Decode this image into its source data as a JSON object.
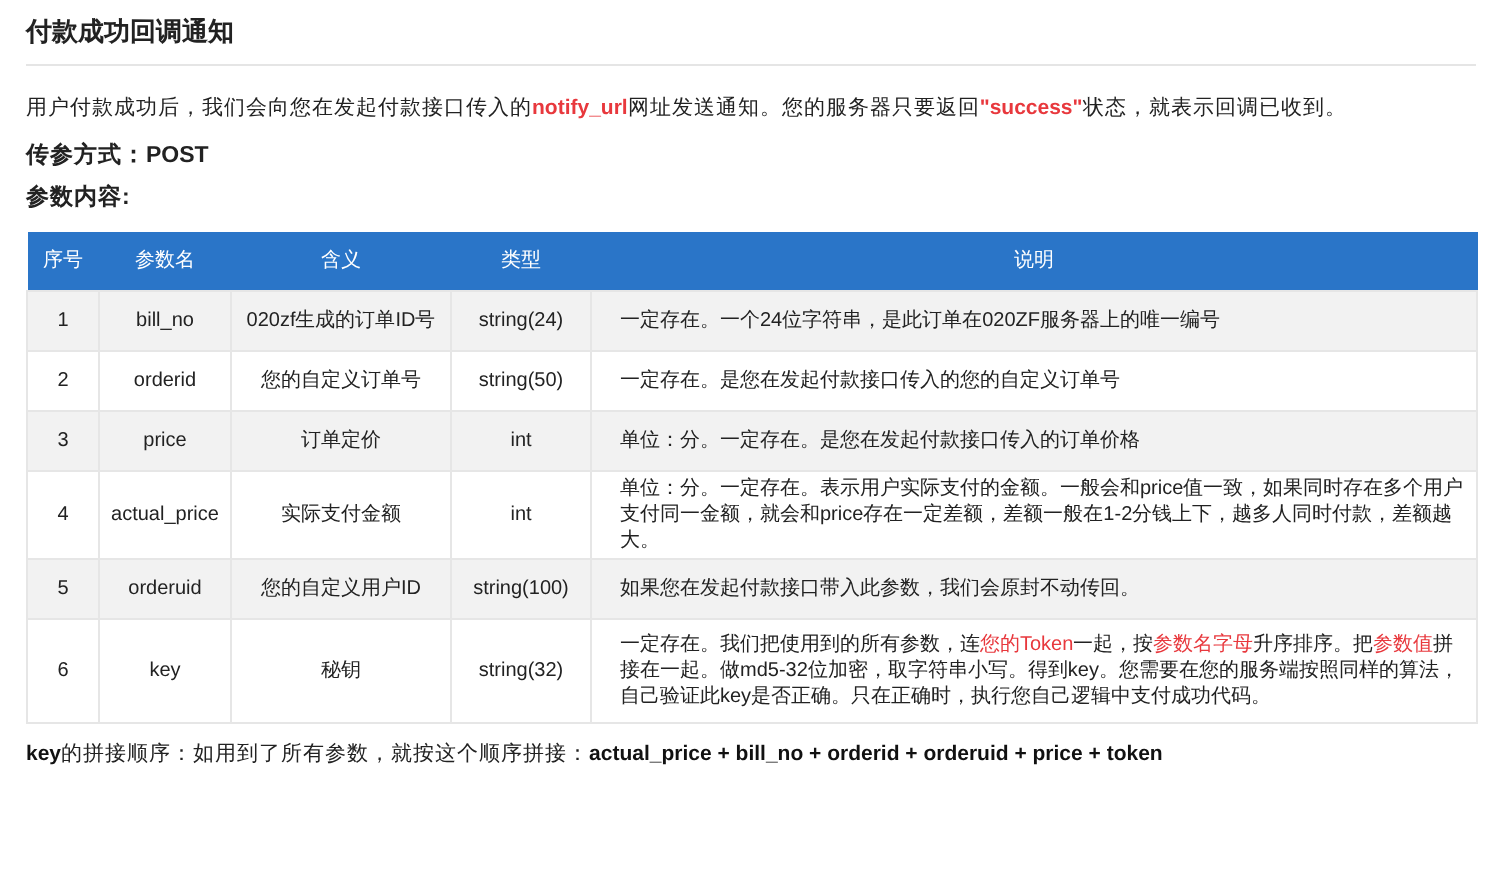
{
  "title": "付款成功回调通知",
  "intro": "用户付款成功后，我们会向您在发起付款接口传入的**notify_url**网址发送通知。您的服务器只要返回**\"success\"**状态，就表示回调已收到。",
  "method": "传参方式：POST",
  "params_heading": "参数内容:",
  "table": {
    "columns": [
      "序号",
      "参数名",
      "含义",
      "类型",
      "说明"
    ],
    "rows": [
      {
        "cells": [
          "1",
          "bill_no",
          "020zf生成的订单ID号",
          "string(24)",
          "一定存在。一个24位字符串，是此订单在020ZF服务器上的唯一编号"
        ]
      },
      {
        "cells": [
          "2",
          "orderid",
          "您的自定义订单号",
          "string(50)",
          "一定存在。是您在发起付款接口传入的您的自定义订单号"
        ]
      },
      {
        "cells": [
          "3",
          "price",
          "订单定价",
          "int",
          "单位：分。一定存在。是您在发起付款接口传入的订单价格"
        ]
      },
      {
        "cells": [
          "4",
          "actual_price",
          "实际支付金额",
          "int",
          "单位：分。一定存在。表示用户实际支付的金额。一般会和price值一致，如果同时存在多个用户支付同一金额，就会和price存在一定差额，差额一般在1-2分钱上下，越多人同时付款，差额越大。"
        ]
      },
      {
        "cells": [
          "5",
          "orderuid",
          "您的自定义用户ID",
          "string(100)",
          "如果您在发起付款接口带入此参数，我们会原封不动传回。"
        ]
      },
      {
        "cells": [
          "6",
          "key",
          "秘钥",
          "string(32)",
          "一定存在。我们把使用到的所有参数，连**您的Token**一起，按**参数名字母**升序排序。把**参数值**拼接在一起。做md5-32位加密，取字符串小写。得到key。您需要在您的服务端按照同样的算法，自己验证此key是否正确。只在正确时，执行您自己逻辑中支付成功代码。"
        ]
      }
    ]
  },
  "footer": "**key**的拼接顺序：如用到了所有参数，就按这个顺序拼接：**actual_price + bill_no + orderid + orderuid + price + token**"
}
